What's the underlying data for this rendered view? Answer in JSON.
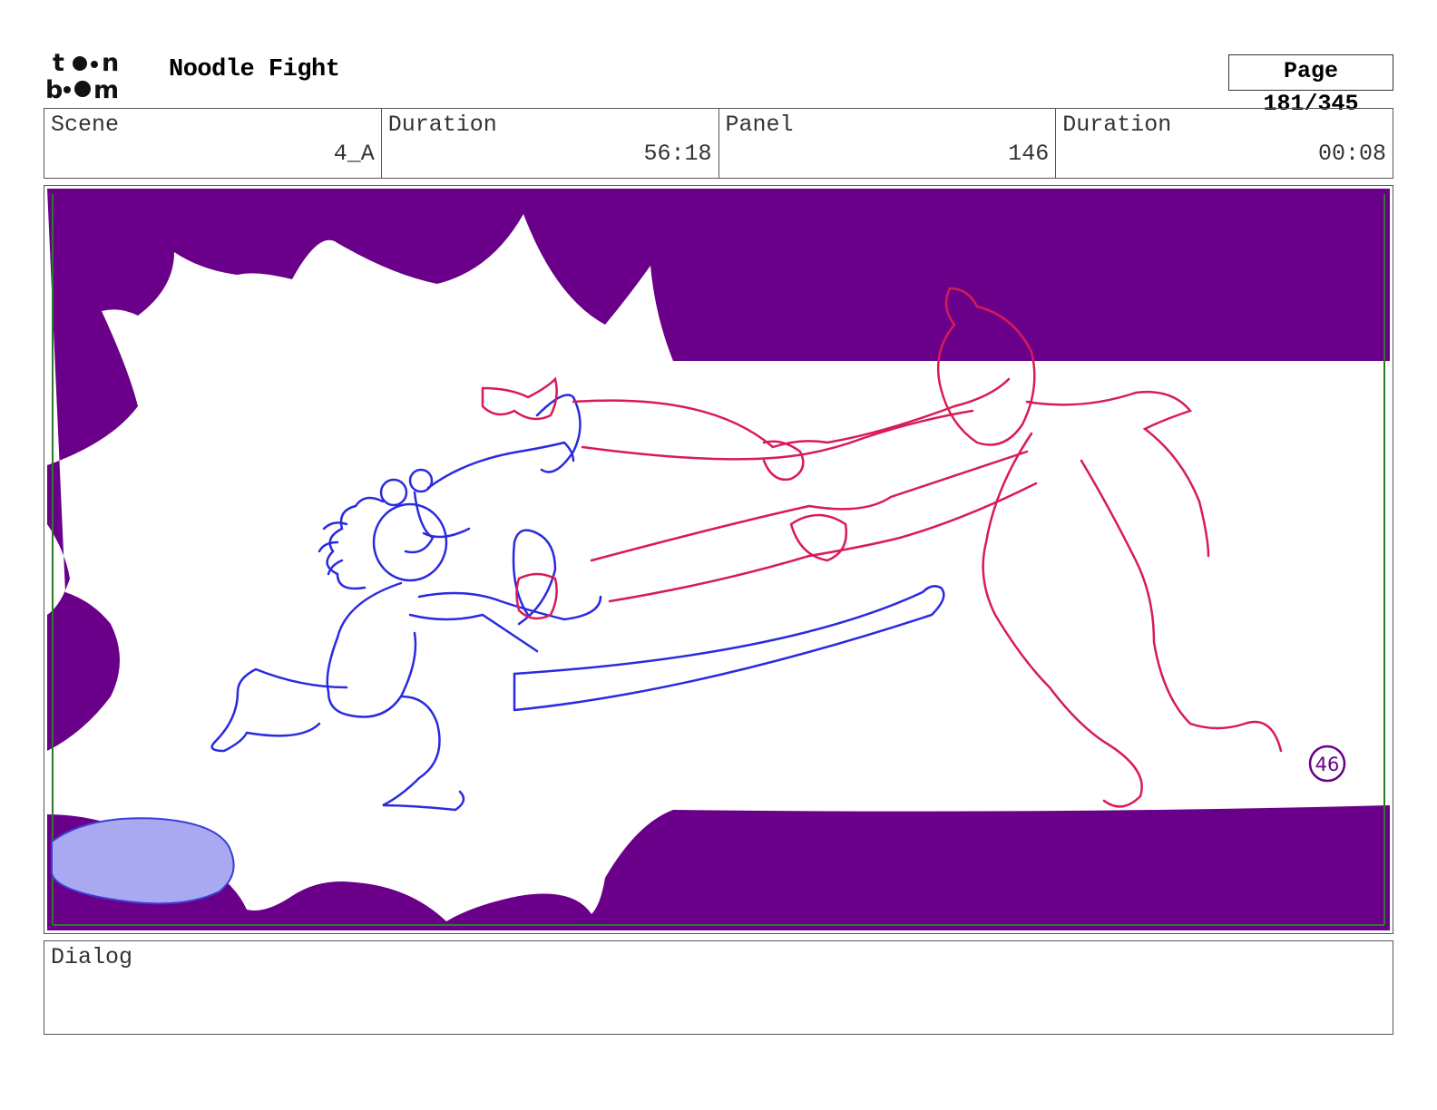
{
  "header": {
    "logo_text_top": "toon",
    "logo_text_bottom": "boom",
    "project_title": "Noodle Fight",
    "page_label": "Page 181/345"
  },
  "info": {
    "scene_label": "Scene",
    "scene_value": "4_A",
    "scene_duration_label": "Duration",
    "scene_duration_value": "56:18",
    "panel_label": "Panel",
    "panel_value": "146",
    "panel_duration_label": "Duration",
    "panel_duration_value": "00:08"
  },
  "panel_image": {
    "background_color": "#6a008a",
    "panel_number_mark": "46"
  },
  "dialog": {
    "label": "Dialog",
    "text": ""
  }
}
